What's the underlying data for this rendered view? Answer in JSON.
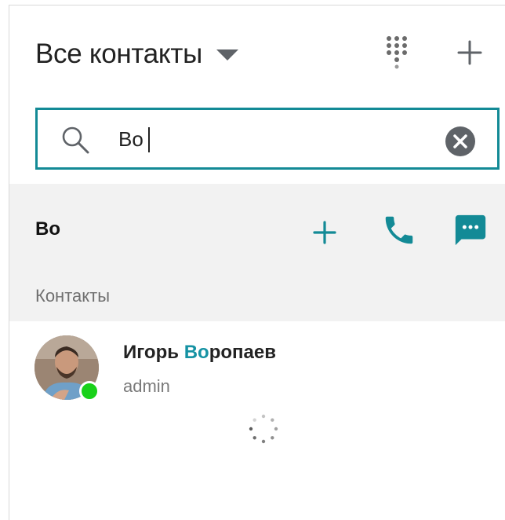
{
  "header": {
    "title": "Все контакты",
    "caret_icon": "caret-down-icon",
    "dialpad_icon": "dialpad-icon",
    "add_icon": "plus-icon"
  },
  "search": {
    "value": "Bo",
    "search_icon": "search-icon",
    "clear_icon": "clear-icon",
    "accent": "#138a96"
  },
  "query_row": {
    "text": "Bo",
    "actions": [
      "plus-icon",
      "phone-icon",
      "chat-icon"
    ],
    "accent": "#138a96"
  },
  "section": {
    "label": "Контакты"
  },
  "contacts": [
    {
      "name_highlight": "Во",
      "name_rest": "ропаев",
      "first_name": "Игорь",
      "role": "admin",
      "status_color": "#19d11a"
    }
  ],
  "loading_icon": "spinner-icon"
}
